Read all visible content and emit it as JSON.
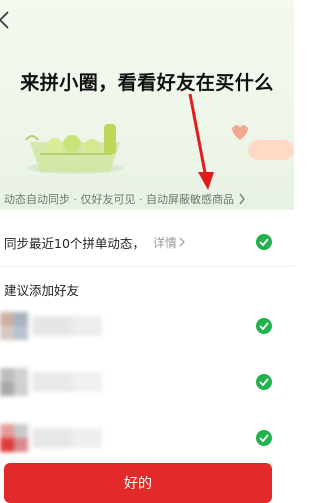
{
  "hero": {
    "title": "来拼小圈，看看好友在买什么",
    "subtitle": "动态自动同步 · 仅好友可见 · 自动屏蔽敏感商品"
  },
  "settings": {
    "sync_label": "同步最近10个拼单动态，",
    "detail_label": "详情",
    "sync_checked": true
  },
  "suggest": {
    "title": "建议添加好友",
    "friends": [
      {
        "checked": true
      },
      {
        "checked": true
      },
      {
        "checked": true
      }
    ]
  },
  "actions": {
    "ok_label": "好的"
  },
  "colors": {
    "accent": "#e22a2a",
    "check": "#22b14c",
    "annotation_arrow": "#e21b1b"
  }
}
